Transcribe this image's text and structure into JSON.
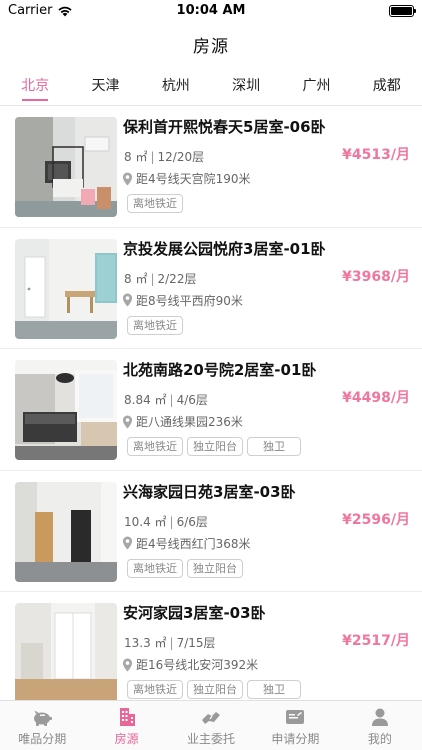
{
  "status": {
    "carrier": "Carrier",
    "time": "10:04 AM"
  },
  "nav": {
    "title": "房源"
  },
  "cities": [
    {
      "label": "北京",
      "active": true
    },
    {
      "label": "天津",
      "active": false
    },
    {
      "label": "杭州",
      "active": false
    },
    {
      "label": "深圳",
      "active": false
    },
    {
      "label": "广州",
      "active": false
    },
    {
      "label": "成都",
      "active": false
    }
  ],
  "listings": [
    {
      "title": "保利首开熙悦春天5居室-06卧",
      "area": "8 ㎡",
      "floor": "12/20层",
      "metro": "距4号线天宫院190米",
      "price": "¥4513/月",
      "tags": [
        "离地铁近"
      ]
    },
    {
      "title": "京投发展公园悦府3居室-01卧",
      "area": "8 ㎡",
      "floor": "2/22层",
      "metro": "距8号线平西府90米",
      "price": "¥3968/月",
      "tags": [
        "离地铁近"
      ]
    },
    {
      "title": "北苑南路20号院2居室-01卧",
      "area": "8.84 ㎡",
      "floor": "4/6层",
      "metro": "距八通线果园236米",
      "price": "¥4498/月",
      "tags": [
        "离地铁近",
        "独立阳台",
        "独卫"
      ]
    },
    {
      "title": "兴海家园日苑3居室-03卧",
      "area": "10.4 ㎡",
      "floor": "6/6层",
      "metro": "距4号线西红门368米",
      "price": "¥2596/月",
      "tags": [
        "离地铁近",
        "独立阳台"
      ]
    },
    {
      "title": "安河家园3居室-03卧",
      "area": "13.3 ㎡",
      "floor": "7/15层",
      "metro": "距16号线北安河392米",
      "price": "¥2517/月",
      "tags": [
        "离地铁近",
        "独立阳台",
        "独卫"
      ]
    }
  ],
  "tabs": [
    {
      "label": "唯品分期",
      "icon": "piggy-bank-icon",
      "active": false
    },
    {
      "label": "房源",
      "icon": "building-icon",
      "active": true
    },
    {
      "label": "业主委托",
      "icon": "handshake-icon",
      "active": false
    },
    {
      "label": "申请分期",
      "icon": "id-card-icon",
      "active": false
    },
    {
      "label": "我的",
      "icon": "user-icon",
      "active": false
    }
  ],
  "colors": {
    "accent": "#e8669a",
    "price": "#f0759f",
    "tab_inactive": "#8a8a8a"
  }
}
